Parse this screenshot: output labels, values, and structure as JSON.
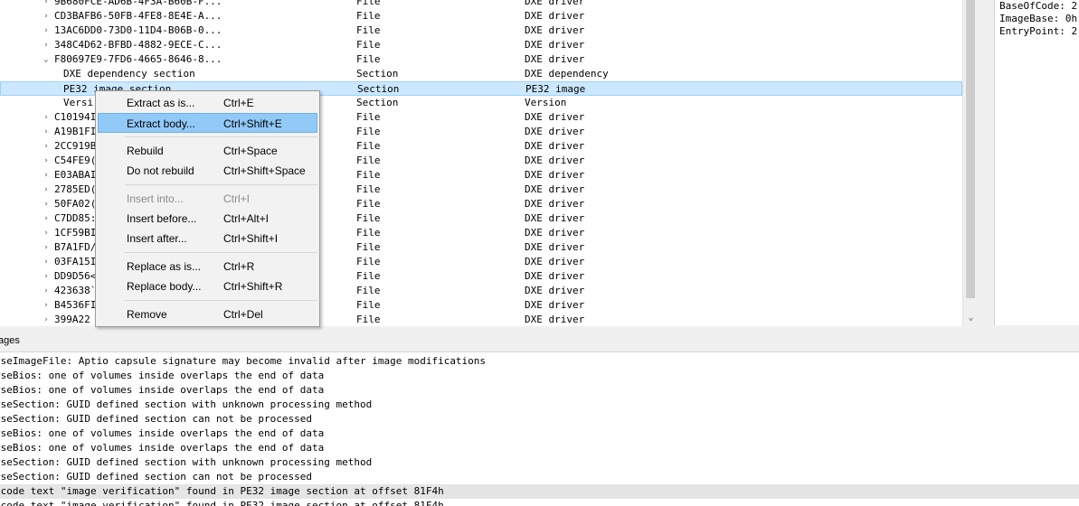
{
  "tree": {
    "rows": [
      {
        "arrow": "›",
        "name": "9B680FCE-AD6B-4F3A-B60B-F...",
        "type": "File",
        "subtype": "DXE driver"
      },
      {
        "arrow": "›",
        "name": "CD3BAFB6-50FB-4FE8-8E4E-A...",
        "type": "File",
        "subtype": "DXE driver"
      },
      {
        "arrow": "›",
        "name": "13AC6DD0-73D0-11D4-B06B-0...",
        "type": "File",
        "subtype": "DXE driver"
      },
      {
        "arrow": "›",
        "name": "348C4D62-BFBD-4882-9ECE-C...",
        "type": "File",
        "subtype": "DXE driver"
      },
      {
        "arrow": "⌄",
        "name": "F80697E9-7FD6-4665-8646-8...",
        "type": "File",
        "subtype": "DXE driver"
      },
      {
        "arrow": "",
        "child": true,
        "name": "DXE dependency section",
        "type": "Section",
        "subtype": "DXE dependency"
      },
      {
        "arrow": "",
        "child": true,
        "selected": true,
        "name": "PE32 image section",
        "type": "Section",
        "subtype": "PE32 image"
      },
      {
        "arrow": "",
        "child": true,
        "name": "Versi",
        "type": "Section",
        "subtype": "Version"
      },
      {
        "arrow": "›",
        "name": "C10194I",
        "type": "File",
        "subtype": "DXE driver"
      },
      {
        "arrow": "›",
        "name": "A19B1FI",
        "type": "File",
        "subtype": "DXE driver"
      },
      {
        "arrow": "›",
        "name": "2CC919B",
        "type": "File",
        "subtype": "DXE driver"
      },
      {
        "arrow": "›",
        "name": "C54FE9(",
        "type": "File",
        "subtype": "DXE driver"
      },
      {
        "arrow": "›",
        "name": "E03ABAI",
        "type": "File",
        "subtype": "DXE driver"
      },
      {
        "arrow": "›",
        "name": "2785ED(",
        "type": "File",
        "subtype": "DXE driver"
      },
      {
        "arrow": "›",
        "name": "50FA02(",
        "type": "File",
        "subtype": "DXE driver"
      },
      {
        "arrow": "›",
        "name": "C7DD85:",
        "type": "File",
        "subtype": "DXE driver"
      },
      {
        "arrow": "›",
        "name": "1CF59BI",
        "type": "File",
        "subtype": "DXE driver"
      },
      {
        "arrow": "›",
        "name": "B7A1FD/",
        "type": "File",
        "subtype": "DXE driver"
      },
      {
        "arrow": "›",
        "name": "03FA15I",
        "type": "File",
        "subtype": "DXE driver"
      },
      {
        "arrow": "›",
        "name": "DD9D56<",
        "type": "File",
        "subtype": "DXE driver"
      },
      {
        "arrow": "›",
        "name": "423638`",
        "type": "File",
        "subtype": "DXE driver"
      },
      {
        "arrow": "›",
        "name": "B4536FI",
        "type": "File",
        "subtype": "DXE driver"
      },
      {
        "arrow": "›",
        "name": "399A22",
        "type": "File",
        "subtype": "DXE driver"
      }
    ]
  },
  "info": {
    "lines": [
      "BaseOfCode: 2",
      "ImageBase: 0h",
      "EntryPoint: 2"
    ]
  },
  "messages_header": "ages",
  "messages": [
    {
      "text": "rseImageFile: Aptio capsule signature may become invalid after image modifications"
    },
    {
      "text": "rseBios: one of volumes inside overlaps the end of data"
    },
    {
      "text": "rseBios: one of volumes inside overlaps the end of data"
    },
    {
      "text": "rseSection: GUID defined section with unknown processing method"
    },
    {
      "text": "rseSection: GUID defined section can not be processed"
    },
    {
      "text": "rseBios: one of volumes inside overlaps the end of data"
    },
    {
      "text": "rseBios: one of volumes inside overlaps the end of data"
    },
    {
      "text": "rseSection: GUID defined section with unknown processing method"
    },
    {
      "text": "rseSection: GUID defined section can not be processed"
    },
    {
      "text": "icode text \"image verification\" found in PE32 image section at offset 81F4h",
      "highlight": true
    },
    {
      "text": "icode text \"image verification\" found in PE32 image section at offset 81F4h"
    }
  ],
  "context_menu": {
    "items": [
      {
        "label": "Extract as is...",
        "shortcut": "Ctrl+E"
      },
      {
        "label": "Extract body...",
        "shortcut": "Ctrl+Shift+E",
        "active": true
      },
      {
        "sep": true
      },
      {
        "label": "Rebuild",
        "shortcut": "Ctrl+Space"
      },
      {
        "label": "Do not rebuild",
        "shortcut": "Ctrl+Shift+Space"
      },
      {
        "sep": true
      },
      {
        "label": "Insert into...",
        "shortcut": "Ctrl+I",
        "disabled": true
      },
      {
        "label": "Insert before...",
        "shortcut": "Ctrl+Alt+I"
      },
      {
        "label": "Insert after...",
        "shortcut": "Ctrl+Shift+I"
      },
      {
        "sep": true
      },
      {
        "label": "Replace as is...",
        "shortcut": "Ctrl+R"
      },
      {
        "label": "Replace body...",
        "shortcut": "Ctrl+Shift+R"
      },
      {
        "sep": true
      },
      {
        "label": "Remove",
        "shortcut": "Ctrl+Del"
      }
    ]
  },
  "colors": {
    "selection": "#cce8ff",
    "menu_highlight": "#91c9f7",
    "message_highlight": "#e5e5e5"
  }
}
